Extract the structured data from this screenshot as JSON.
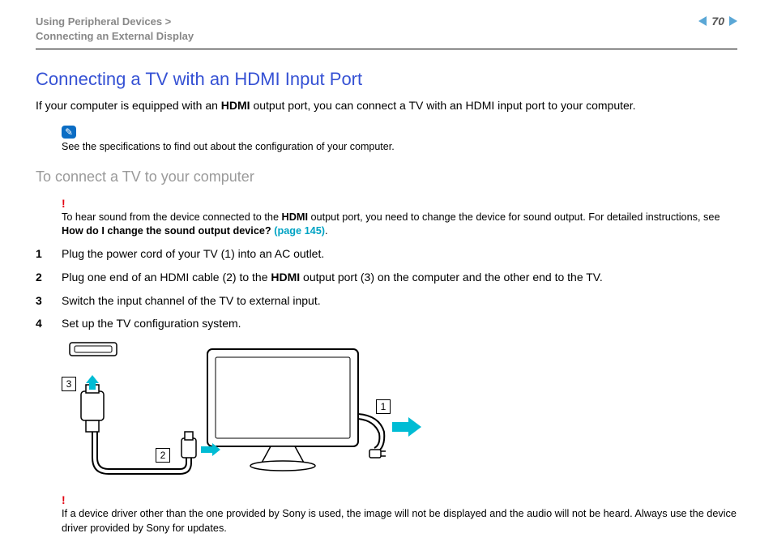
{
  "header": {
    "breadcrumb_line1": "Using Peripheral Devices >",
    "breadcrumb_line2": "Connecting an External Display",
    "page_number": "70"
  },
  "title": "Connecting a TV with an HDMI Input Port",
  "intro": {
    "pre": "If your computer is equipped with an ",
    "bold": "HDMI",
    "post": " output port, you can connect a TV with an HDMI input port to your computer."
  },
  "note1": {
    "icon_glyph": "✎",
    "text": "See the specifications to find out about the configuration of your computer."
  },
  "subhead": "To connect a TV to your computer",
  "warn1": {
    "icon": "!",
    "pre": "To hear sound from the device connected to the ",
    "bold1": "HDMI",
    "mid": " output port, you need to change the device for sound output. For detailed instructions, see ",
    "bold2": "How do I change the sound output device? ",
    "link": "(page 145)",
    "post": "."
  },
  "steps": [
    {
      "n": "1",
      "text": "Plug the power cord of your TV (1) into an AC outlet."
    },
    {
      "n": "2",
      "pre": "Plug one end of an HDMI cable (2) to the ",
      "bold": "HDMI",
      "post": " output port (3) on the computer and the other end to the TV."
    },
    {
      "n": "3",
      "text": "Switch the input channel of the TV to external input."
    },
    {
      "n": "4",
      "text": "Set up the TV configuration system."
    }
  ],
  "figure": {
    "callouts": {
      "c1": "1",
      "c2": "2",
      "c3": "3"
    }
  },
  "warn2": {
    "icon": "!",
    "text": "If a device driver other than the one provided by Sony is used, the image will not be displayed and the audio will not be heard. Always use the device driver provided by Sony for updates."
  }
}
